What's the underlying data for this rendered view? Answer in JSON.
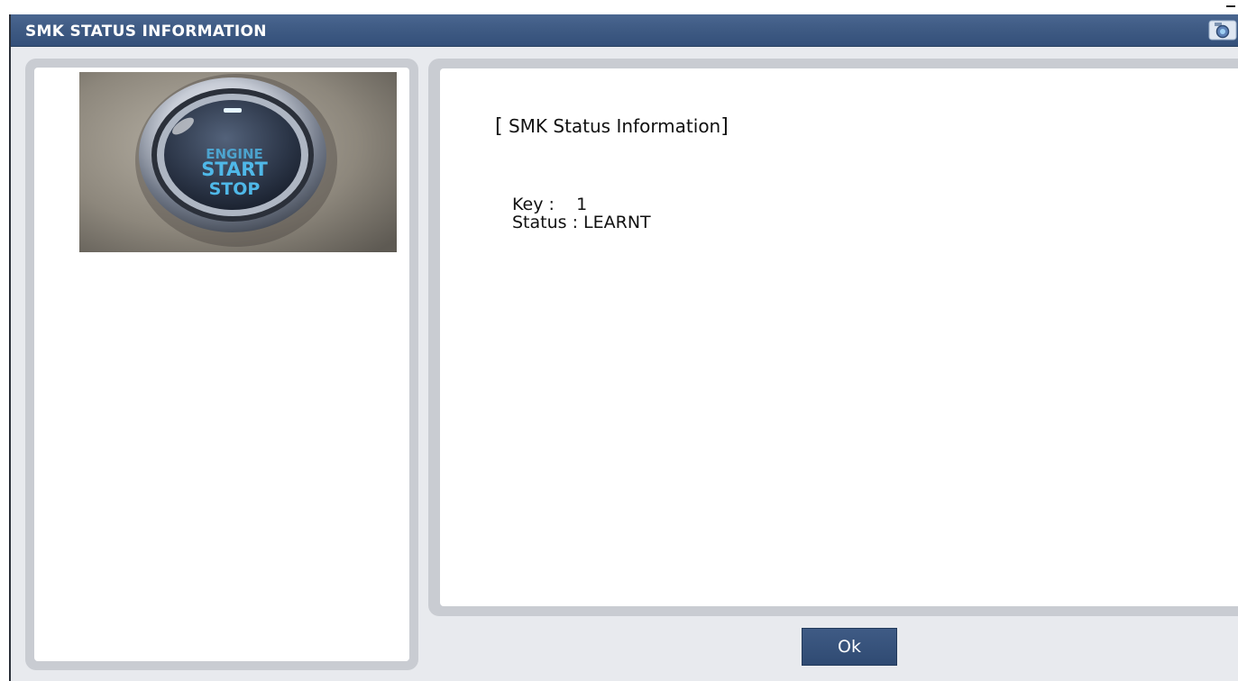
{
  "window": {
    "title": "SMK STATUS INFORMATION"
  },
  "titlebar": {
    "camera_icon": "camera-icon"
  },
  "left_panel": {
    "image_icon": "engine-start-stop-button-image",
    "image_label": "ENGINE START STOP"
  },
  "info": {
    "header_open": "[",
    "header_text": " SMK Status Information",
    "header_close": "]",
    "key_label": "Key :",
    "key_value": "1",
    "status_label": "Status :",
    "status_value": "LEARNT"
  },
  "footer": {
    "ok_label": "Ok"
  },
  "colors": {
    "titlebar": "#3e5a83",
    "panel_border": "#c9ccd2",
    "button_blue": "#2f4a72",
    "photo_text_blue": "#4fb8e8"
  }
}
